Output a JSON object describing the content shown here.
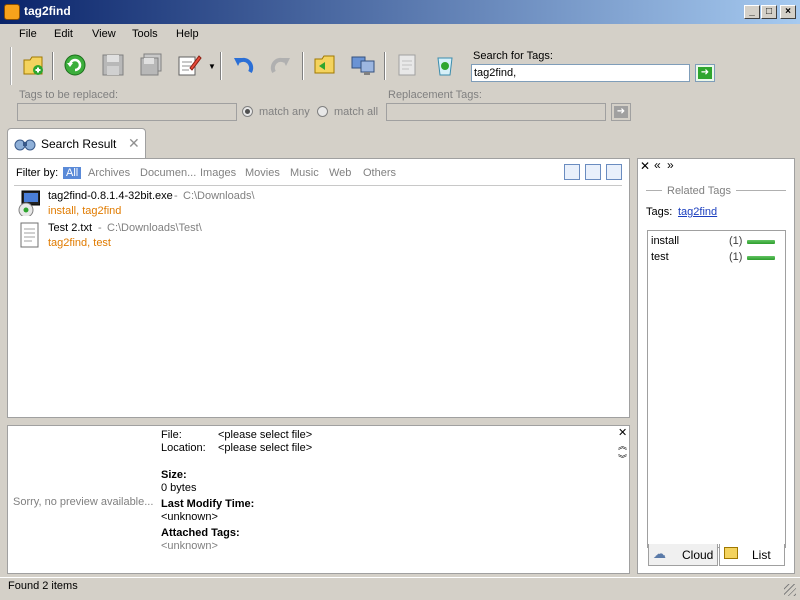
{
  "window": {
    "title": "tag2find"
  },
  "menu": [
    "File",
    "Edit",
    "View",
    "Tools",
    "Help"
  ],
  "search": {
    "label": "Search for Tags:",
    "value": "tag2find,"
  },
  "replace": {
    "label": "Tags to be replaced:",
    "match_any": "match any",
    "match_all": "match all",
    "replacement_label": "Replacement Tags:"
  },
  "tab": {
    "label": "Search Result"
  },
  "filter": {
    "label": "Filter by:",
    "items": [
      "All",
      "Archives",
      "Documen...",
      "Images",
      "Movies",
      "Music",
      "Web",
      "Others"
    ]
  },
  "results": [
    {
      "name": "tag2find-0.8.1.4-32bit.exe",
      "sep": "-",
      "path": "C:\\Downloads\\",
      "tags": "install, tag2find"
    },
    {
      "name": "Test 2.txt",
      "sep": "-",
      "path": "C:\\Downloads\\Test\\",
      "tags": "tag2find, test"
    }
  ],
  "details": {
    "no_preview": "Sorry, no preview available...",
    "file_label": "File:",
    "file_value": "<please select file>",
    "location_label": "Location:",
    "location_value": "<please select file>",
    "size_label": "Size:",
    "size_value": "0 bytes",
    "modify_label": "Last Modify Time:",
    "modify_value": "<unknown>",
    "tags_label": "Attached Tags:",
    "tags_value": "<unknown>"
  },
  "related": {
    "title": "Related Tags",
    "tags_label": "Tags:",
    "tags_link": "tag2find",
    "list": [
      {
        "name": "install",
        "count": "(1)"
      },
      {
        "name": "test",
        "count": "(1)"
      }
    ],
    "tab_cloud": "Cloud",
    "tab_list": "List"
  },
  "status": {
    "text": "Found 2 items"
  },
  "colors": {
    "accent": "#0a246a",
    "tag_orange": "#e07b00",
    "link_blue": "#1b3fbf",
    "filter_active": "#5a8ad8"
  },
  "icons": [
    "new-tag-icon",
    "refresh-icon",
    "save-icon",
    "save-all-icon",
    "edit-icon",
    "undo-icon",
    "redo-icon",
    "open-folder-icon",
    "computer-icon",
    "document-icon",
    "recycle-icon"
  ]
}
